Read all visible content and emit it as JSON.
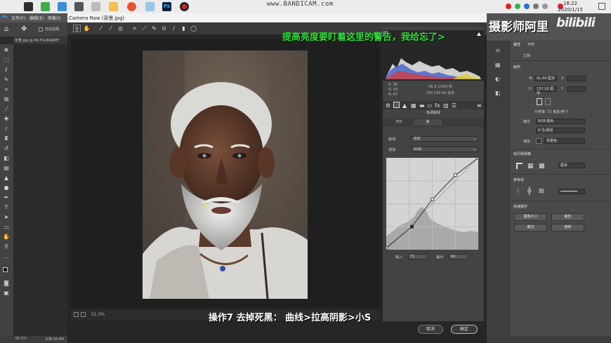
{
  "taskbar": {
    "recorder": "www.BANDICAM.com",
    "time": "18:22",
    "date": "2020/1/15"
  },
  "ps": {
    "menu": [
      "文件(F)",
      "编辑(E)",
      "图像(I)"
    ],
    "option_label": "自动选择:",
    "doc_tab": "背景.jpg @ 60.5%(RGB/8*",
    "status_zoom": "60.5%",
    "status_doc": "文档:28.8M"
  },
  "acr": {
    "title": "Camera Raw (背景.jpg)",
    "zoom": "51.3%",
    "rgb": {
      "r_label": "R:",
      "r": "38",
      "g_label": "G:",
      "g": "43",
      "b_label": "B:",
      "b": "47"
    },
    "exif": {
      "line1": "f/6.8  1/200 秒",
      "line2": "250 160   60 毫米"
    },
    "panel_name": "色调曲线",
    "subtabs": [
      "参数",
      "点"
    ],
    "curve_label": "曲线:",
    "curve_value": "自定",
    "channel_label": "通道:",
    "channel_value": "RGB",
    "input_label": "输入:",
    "input_value": "71",
    "output_label": "输出:",
    "output_value": "64",
    "cancel": "取消",
    "ok": "确定",
    "curve_points": [
      [
        0,
        5
      ],
      [
        71,
        64
      ],
      [
        128,
        140
      ],
      [
        192,
        207
      ],
      [
        255,
        255
      ]
    ]
  },
  "captions": {
    "top": "提高亮度要盯着这里的警告，我给忘了>",
    "bottom": "操作7   去掉死黑：  曲线>拉高阴影>小S"
  },
  "right": {
    "watermark": "摄影师阿里",
    "bili": "bilibili",
    "tabs": [
      "属性",
      "字符"
    ],
    "doc_label": "文档",
    "canvas_section": "画布",
    "w_label": "W",
    "w_value": "91.44 厘米",
    "h_label": "H",
    "h_value": "137.16 厘米",
    "x_label": "X",
    "y_label": "Y",
    "resolution": "分辨率: 72 像素/英寸",
    "mode_label": "模式",
    "mode_value": "RGB 颜色",
    "depth_value": "8 位/通道",
    "fill_label": "填色",
    "fill_value": "背景色",
    "rulers_section": "标尺和网格",
    "unit_value": "厘米",
    "guides_section": "参考线",
    "quick_section": "快速操作",
    "btn_image_size": "图像大小",
    "btn_crop": "裁剪",
    "btn_trim": "裁切",
    "btn_rotate": "旋转"
  },
  "colors": {
    "caption_green": "#33e03a",
    "caption_white": "#ffffff",
    "acr_bg": "#262626",
    "panel_bg": "#434343"
  }
}
